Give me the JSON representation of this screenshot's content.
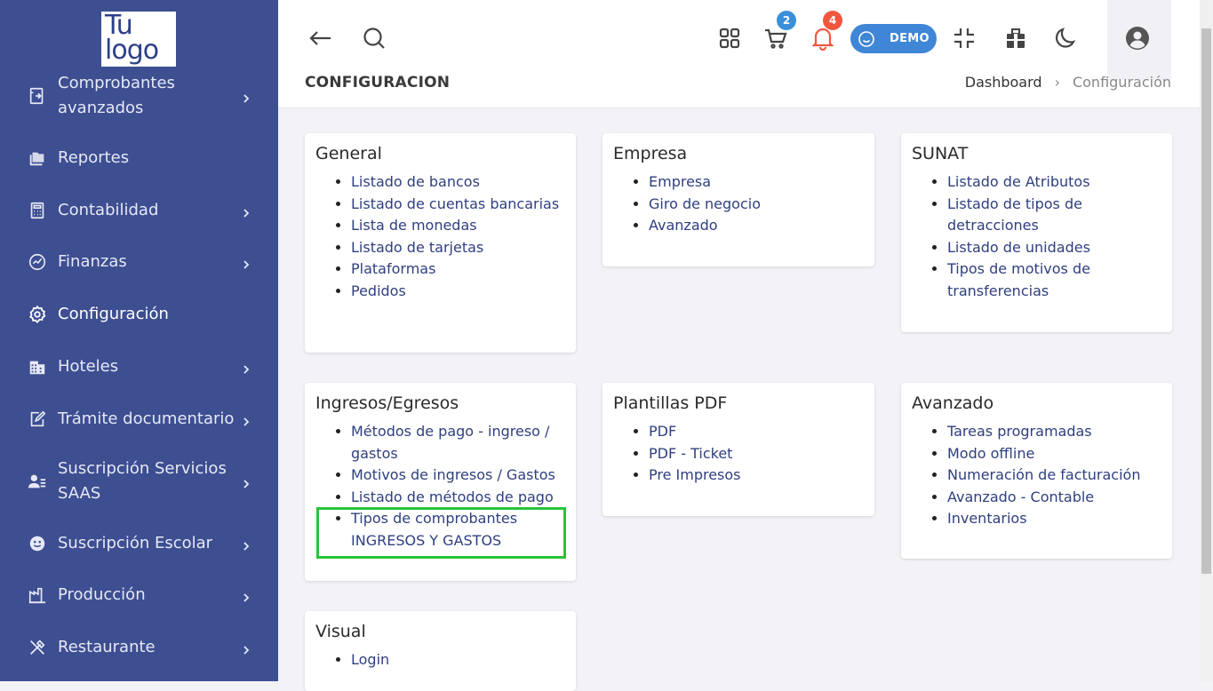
{
  "logo": {
    "line1": "Tu",
    "line2": "logo"
  },
  "sidebar": {
    "items": [
      {
        "label": "Comprobantes avanzados",
        "icon": "document-arrow-icon",
        "chevron": true
      },
      {
        "label": "Reportes",
        "icon": "folders-icon",
        "chevron": false
      },
      {
        "label": "Contabilidad",
        "icon": "calculator-icon",
        "chevron": true
      },
      {
        "label": "Finanzas",
        "icon": "chart-trend-icon",
        "chevron": true
      },
      {
        "label": "Configuración",
        "icon": "gear-icon",
        "chevron": false,
        "active": true
      },
      {
        "label": "Hoteles",
        "icon": "building-icon",
        "chevron": true
      },
      {
        "label": "Trámite documentario",
        "icon": "document-edit-icon",
        "chevron": true
      },
      {
        "label": "Suscripción Servicios SAAS",
        "icon": "user-list-icon",
        "chevron": true
      },
      {
        "label": "Suscripción Escolar",
        "icon": "smiley-icon",
        "chevron": true
      },
      {
        "label": "Producción",
        "icon": "factory-icon",
        "chevron": true
      },
      {
        "label": "Restaurante",
        "icon": "utensils-icon",
        "chevron": true
      }
    ]
  },
  "topbar": {
    "cart_badge": "2",
    "bell_badge": "4",
    "demo_label": "DEMO"
  },
  "page": {
    "title": "CONFIGURACION",
    "breadcrumb": [
      "Dashboard",
      "Configuración"
    ]
  },
  "cards": [
    {
      "title": "General",
      "items": [
        "Listado de bancos",
        "Listado de cuentas bancarias",
        "Lista de monedas",
        "Listado de tarjetas",
        "Plataformas",
        "Pedidos"
      ]
    },
    {
      "title": "Empresa",
      "items": [
        "Empresa",
        "Giro de negocio",
        "Avanzado"
      ]
    },
    {
      "title": "SUNAT",
      "items": [
        "Listado de Atributos",
        "Listado de tipos de detracciones",
        "Listado de unidades",
        "Tipos de motivos de transferencias"
      ]
    },
    {
      "title": "Ingresos/Egresos",
      "items": [
        "Métodos de pago - ingreso / gastos",
        "Motivos de ingresos / Gastos",
        "Listado de métodos de pago",
        "Tipos de comprobantes INGRESOS Y GASTOS"
      ]
    },
    {
      "title": "Plantillas PDF",
      "items": [
        "PDF",
        "PDF - Ticket",
        "Pre Impresos"
      ]
    },
    {
      "title": "Avanzado",
      "items": [
        "Tareas programadas",
        "Modo offline",
        "Numeración de facturación",
        "Avanzado - Contable",
        "Inventarios"
      ]
    },
    {
      "title": "Visual",
      "items": [
        "Login"
      ]
    }
  ],
  "colors": {
    "sidebar_bg": "#3d4e91",
    "cart_badge": "#3a8fd9",
    "bell_badge": "#f0573f",
    "demo_bg": "#3f86d6",
    "highlight": "#27c43a"
  }
}
